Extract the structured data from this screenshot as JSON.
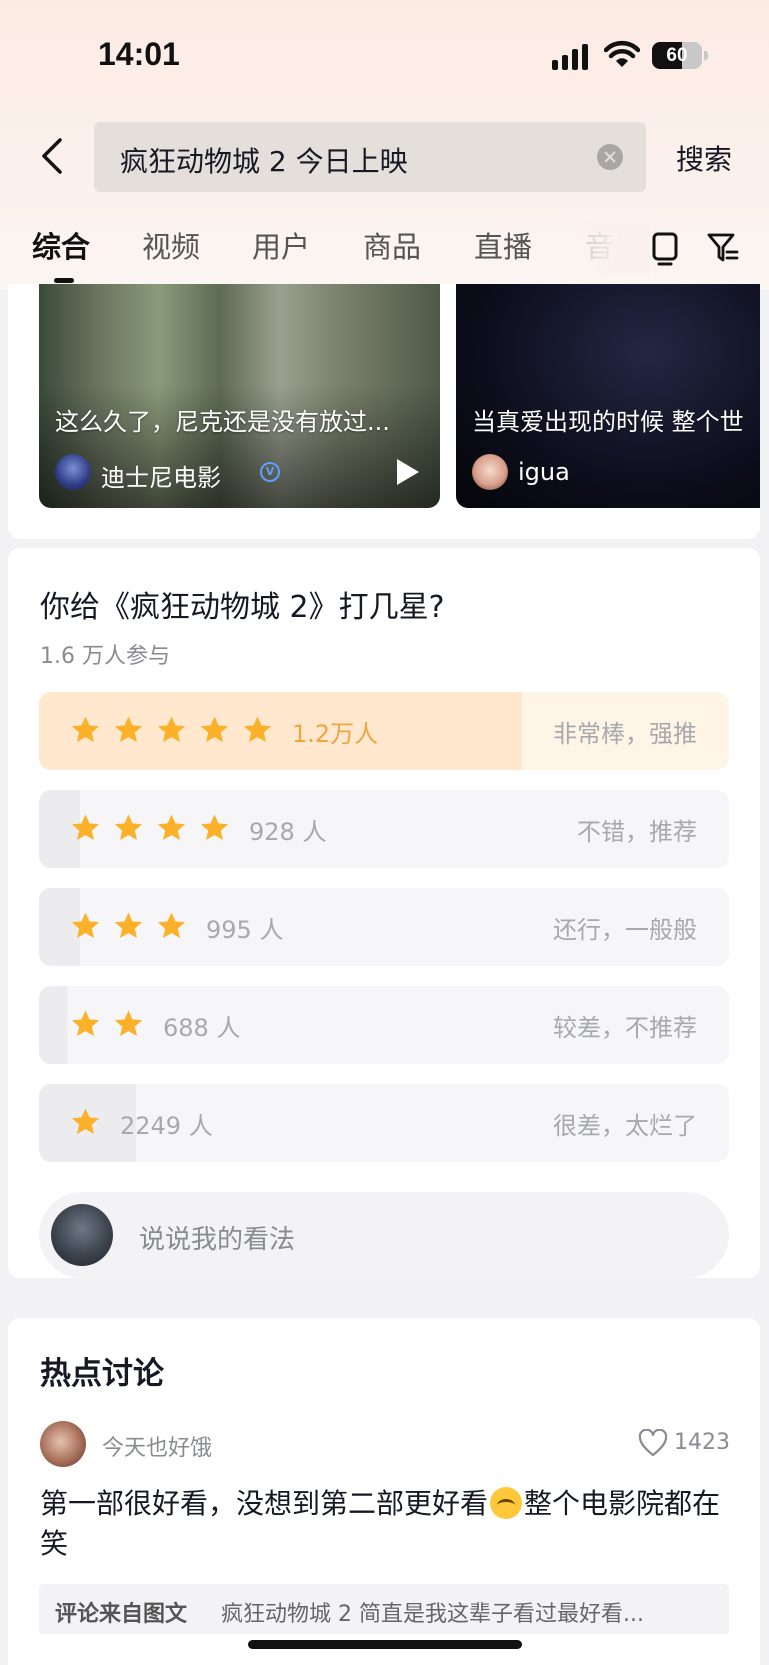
{
  "status_bar": {
    "time": "14:01",
    "battery": "60",
    "battery_level": 0.6
  },
  "search": {
    "query": "疯狂动物城 2 今日上映",
    "button": "搜索"
  },
  "tabs": [
    {
      "label": "综合",
      "active": true
    },
    {
      "label": "视频"
    },
    {
      "label": "用户"
    },
    {
      "label": "商品"
    },
    {
      "label": "直播"
    },
    {
      "label": "音乐"
    }
  ],
  "videos": [
    {
      "title": "这么久了，尼克还是没有放过...",
      "author": "迪士尼电影",
      "verified": true
    },
    {
      "title": "当真爱出现的时候 整个世",
      "author": "igua"
    }
  ],
  "poll": {
    "title": "你给《疯狂动物城 2》打几星?",
    "participants": "1.6 万人参与",
    "options": [
      {
        "stars": 5,
        "count": "1.2万人",
        "desc": "非常棒，强推",
        "share": 0.7
      },
      {
        "stars": 4,
        "count": "928 人",
        "desc": "不错，推荐",
        "share": 0.06
      },
      {
        "stars": 3,
        "count": "995 人",
        "desc": "还行，一般般",
        "share": 0.06
      },
      {
        "stars": 2,
        "count": "688 人",
        "desc": "较差，不推荐",
        "share": 0.04
      },
      {
        "stars": 1,
        "count": "2249 人",
        "desc": "很差，太烂了",
        "share": 0.14
      }
    ],
    "comment_placeholder": "说说我的看法"
  },
  "hot": {
    "title": "热点讨论",
    "user": "今天也好饿",
    "likes": "1423",
    "text_before": "第一部很好看，没想到第二部更好看",
    "text_after": "整个电影院都在笑",
    "emoji": "crying-emoji",
    "source_label": "评论来自图文",
    "source_text": "疯狂动物城 2 简直是我这辈子看过最好看..."
  },
  "colors": {
    "star": "#fbb12a",
    "accent_count": "#f0a545",
    "verified": "#5aa0ff"
  }
}
